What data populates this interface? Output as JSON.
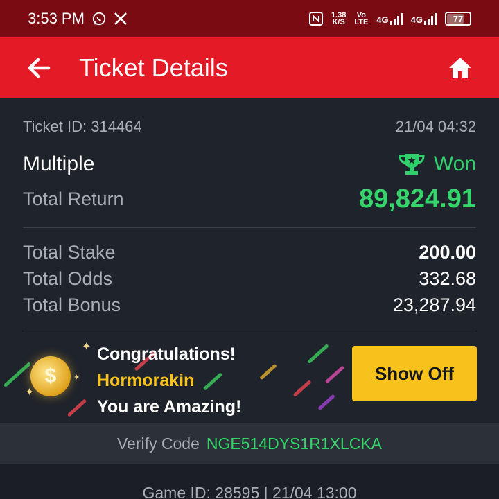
{
  "status_bar": {
    "time": "3:53 PM",
    "net_speed_value": "1.38",
    "net_speed_unit": "K/S",
    "volte_top": "Vo",
    "volte_bottom": "LTE",
    "net1": "4G",
    "net2": "4G",
    "battery": "77",
    "battery_level": 0.77,
    "icons": [
      "whatsapp-icon",
      "x-icon",
      "nfc-icon",
      "signal-icon",
      "battery-icon"
    ]
  },
  "header": {
    "title": "Ticket Details",
    "back_icon": "arrow-left-icon",
    "home_icon": "home-icon",
    "bg_color": "#e51a27"
  },
  "ticket": {
    "id_label": "Ticket ID: 314464",
    "datetime": "21/04 04:32",
    "type": "Multiple",
    "status": "Won",
    "status_icon": "trophy-icon",
    "total_return_label": "Total Return",
    "total_return": "89,824.91",
    "total_stake_label": "Total Stake",
    "total_stake": "200.00",
    "total_odds_label": "Total Odds",
    "total_odds": "332.68",
    "total_bonus_label": "Total Bonus",
    "total_bonus": "23,287.94"
  },
  "promo": {
    "line1": "Congratulations!",
    "name": "Hormorakin",
    "line3": "You are Amazing!",
    "button": "Show Off",
    "coin_symbol": "$"
  },
  "verify": {
    "label": "Verify Code",
    "code": "NGE514DYS1R1XLCKA"
  },
  "game": {
    "info": "Game ID: 28595 | 21/04 13:00"
  },
  "colors": {
    "accent_green": "#35d56c",
    "accent_yellow": "#f7c21b"
  }
}
